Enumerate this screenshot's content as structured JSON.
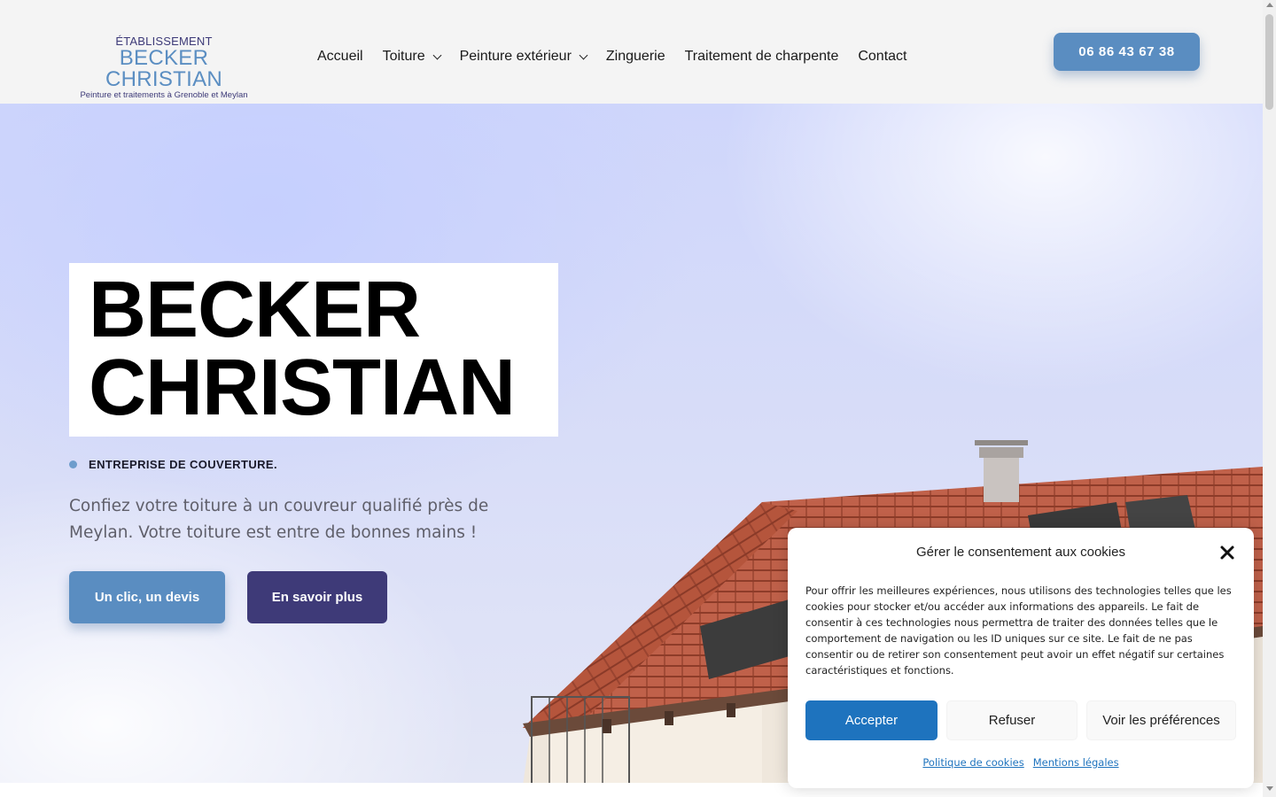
{
  "header": {
    "logo": {
      "top": "ÉTABLISSEMENT",
      "main": "BECKER CHRISTIAN",
      "sub": "Peinture et traitements à Grenoble et Meylan"
    },
    "nav": [
      {
        "label": "Accueil",
        "dropdown": false
      },
      {
        "label": "Toiture",
        "dropdown": true
      },
      {
        "label": "Peinture extérieur",
        "dropdown": true
      },
      {
        "label": "Zinguerie",
        "dropdown": false
      },
      {
        "label": "Traitement de charpente",
        "dropdown": false
      },
      {
        "label": "Contact",
        "dropdown": false
      }
    ],
    "phone": "06 86 43 67 38"
  },
  "hero": {
    "title_line1": "BECKER",
    "title_line2": "CHRISTIAN",
    "tag": "ENTREPRISE DE COUVERTURE.",
    "description": "Confiez votre toiture à un couvreur qualifié près de Meylan. Votre toiture est entre de bonnes mains !",
    "cta_primary": "Un clic, un devis",
    "cta_secondary": "En savoir plus"
  },
  "cookie_banner": {
    "title": "Gérer le consentement aux cookies",
    "text": "Pour offrir les meilleures expériences, nous utilisons des technologies telles que les cookies pour stocker et/ou accéder aux informations des appareils. Le fait de consentir à ces technologies nous permettra de traiter des données telles que le comportement de navigation ou les ID uniques sur ce site. Le fait de ne pas consentir ou de retirer son consentement peut avoir un effet négatif sur certaines caractéristiques et fonctions.",
    "accept": "Accepter",
    "refuse": "Refuser",
    "preferences": "Voir les préférences",
    "link_policy": "Politique de cookies",
    "link_legal": "Mentions légales"
  },
  "colors": {
    "accent_blue": "#5a8dc1",
    "dark_purple": "#3e3a78",
    "cookie_blue": "#1e73be"
  }
}
